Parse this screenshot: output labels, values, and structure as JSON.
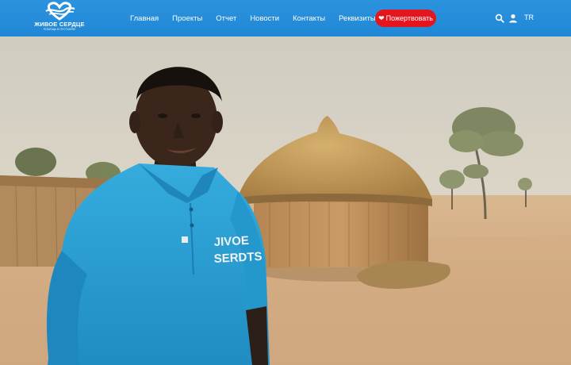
{
  "header": {
    "logo": {
      "name": "ЖИВОЕ СЕРДЦЕ",
      "tagline": "ПОМОЩЬ В ПУСТЫНЯХ",
      "icon": "heart-waves-logo-icon"
    },
    "nav": [
      {
        "label": "Главная"
      },
      {
        "label": "Проекты"
      },
      {
        "label": "Отчет"
      },
      {
        "label": "Новости"
      },
      {
        "label": "Контакты"
      },
      {
        "label": "Реквизиты"
      }
    ],
    "donate_label": "Пожертвовать",
    "search_icon": "search-icon",
    "user_icon": "user-icon",
    "language": "TR"
  },
  "hero": {
    "shirt_text_line1": "JIVOE",
    "shirt_text_line2": "SERDTS"
  },
  "colors": {
    "header_blue": "#2191da",
    "donate_red": "#e5151d",
    "shirt_blue": "#2aa3d6",
    "sand": "#d9b48c",
    "sky": "#d8d4c9"
  }
}
